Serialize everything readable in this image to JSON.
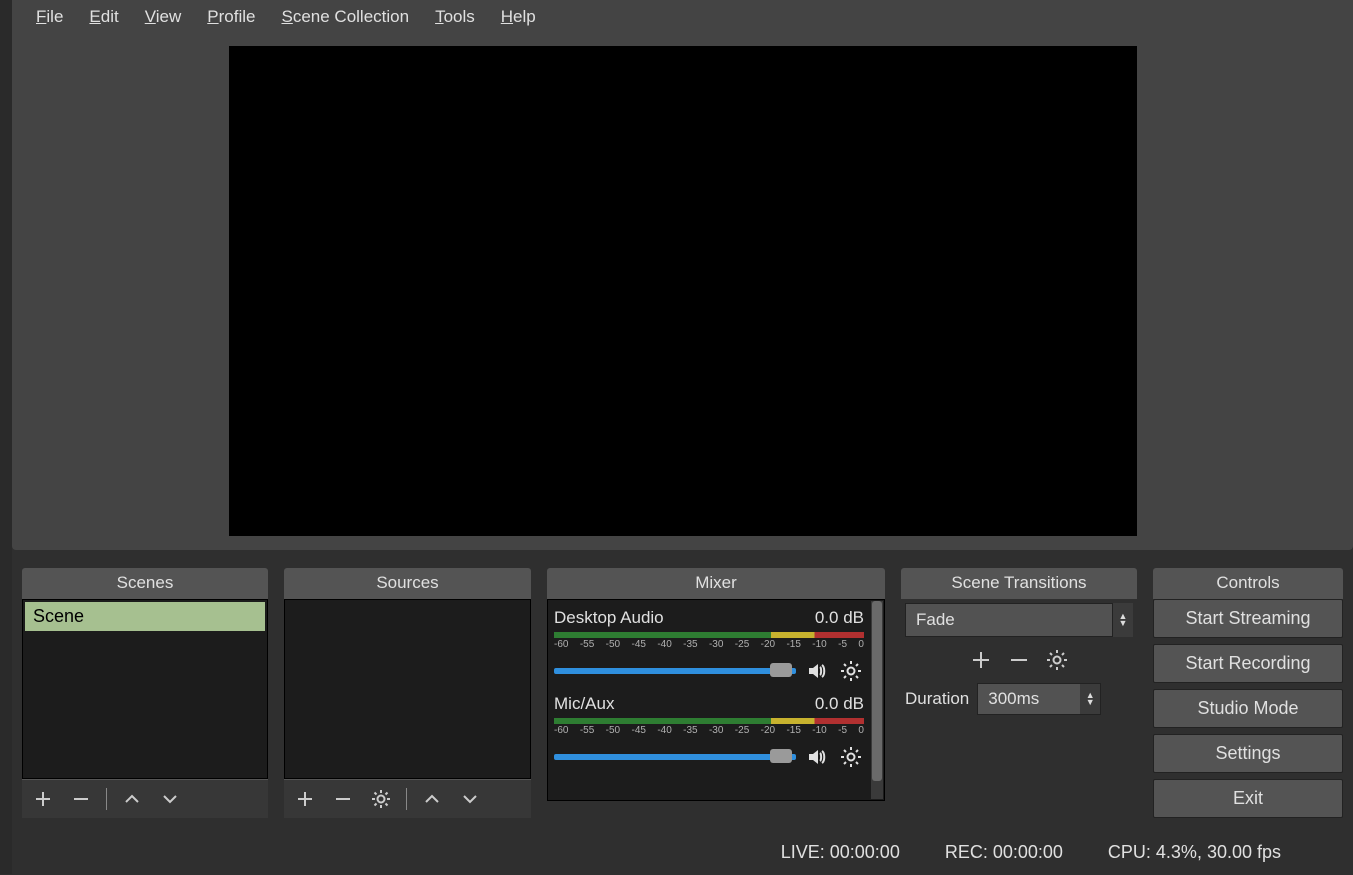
{
  "menu": {
    "items": [
      "File",
      "Edit",
      "View",
      "Profile",
      "Scene Collection",
      "Tools",
      "Help"
    ]
  },
  "panels": {
    "scenes": {
      "title": "Scenes",
      "items": [
        "Scene"
      ]
    },
    "sources": {
      "title": "Sources"
    },
    "mixer": {
      "title": "Mixer",
      "marks": [
        "-60",
        "-55",
        "-50",
        "-45",
        "-40",
        "-35",
        "-30",
        "-25",
        "-20",
        "-15",
        "-10",
        "-5",
        "0"
      ],
      "channels": [
        {
          "name": "Desktop Audio",
          "db": "0.0 dB"
        },
        {
          "name": "Mic/Aux",
          "db": "0.0 dB"
        }
      ]
    },
    "transitions": {
      "title": "Scene Transitions",
      "selected": "Fade",
      "duration_label": "Duration",
      "duration_value": "300ms"
    },
    "controls": {
      "title": "Controls",
      "buttons": [
        "Start Streaming",
        "Start Recording",
        "Studio Mode",
        "Settings",
        "Exit"
      ]
    }
  },
  "status": {
    "live": "LIVE: 00:00:00",
    "rec": "REC: 00:00:00",
    "cpu": "CPU: 4.3%, 30.00 fps"
  }
}
